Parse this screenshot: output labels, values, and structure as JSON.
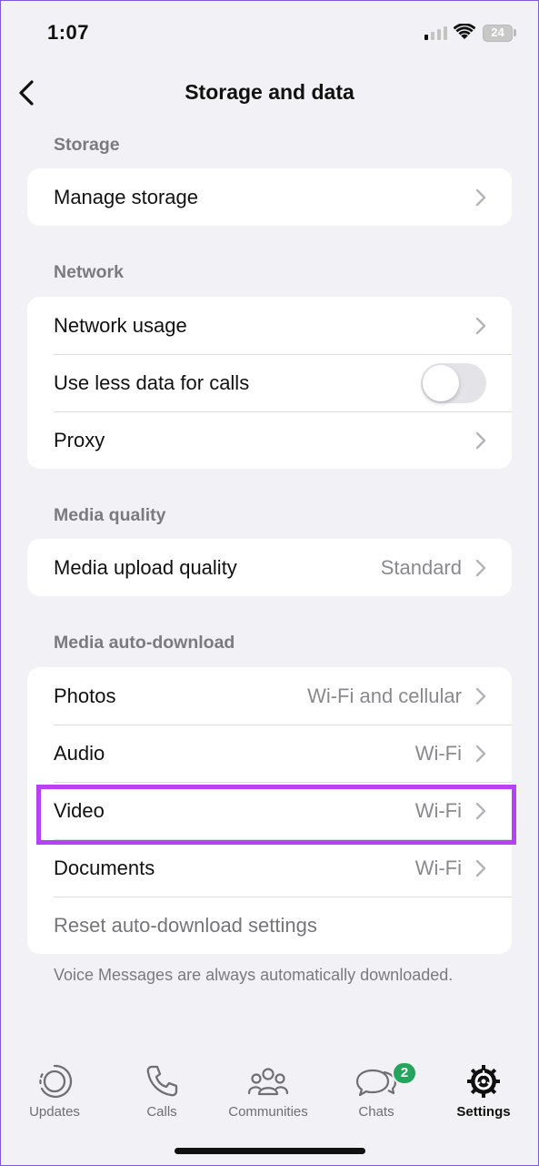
{
  "status_bar": {
    "time": "1:07",
    "battery": "24"
  },
  "nav": {
    "title": "Storage and data"
  },
  "sections": {
    "storage": {
      "header": "Storage",
      "manage": "Manage storage"
    },
    "network": {
      "header": "Network",
      "usage": "Network usage",
      "less_data": "Use less data for calls",
      "less_data_enabled": false,
      "proxy": "Proxy"
    },
    "media_quality": {
      "header": "Media quality",
      "upload_label": "Media upload quality",
      "upload_value": "Standard"
    },
    "auto_download": {
      "header": "Media auto-download",
      "photos_label": "Photos",
      "photos_value": "Wi-Fi and cellular",
      "audio_label": "Audio",
      "audio_value": "Wi-Fi",
      "video_label": "Video",
      "video_value": "Wi-Fi",
      "documents_label": "Documents",
      "documents_value": "Wi-Fi",
      "reset": "Reset auto-download settings",
      "footnote": "Voice Messages are always automatically downloaded."
    }
  },
  "tabbar": {
    "updates": "Updates",
    "calls": "Calls",
    "communities": "Communities",
    "chats": "Chats",
    "chats_badge": "2",
    "settings": "Settings",
    "active": "settings"
  },
  "colors": {
    "highlight": "#b542f5",
    "badge": "#25a45d",
    "background": "#f2f2f6"
  }
}
